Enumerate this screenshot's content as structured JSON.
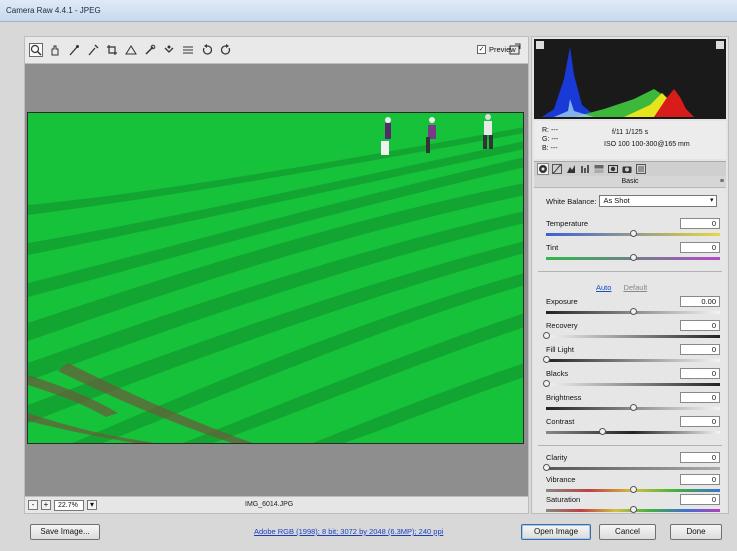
{
  "window": {
    "title": "Camera Raw 4.4.1  -  JPEG"
  },
  "toolbar": {
    "tools": [
      "zoom-icon",
      "hand-icon",
      "white-balance-icon",
      "color-sampler-icon",
      "crop-icon",
      "straighten-icon",
      "retouch-icon",
      "red-eye-icon",
      "preferences-icon",
      "rotate-ccw-icon",
      "rotate-cw-icon"
    ],
    "preview_label": "Preview",
    "preview_checked": "✓"
  },
  "status": {
    "zoom_minus": "-",
    "zoom_plus": "+",
    "zoom_value": "22.7%",
    "filename": "IMG_6014.JPG"
  },
  "readout": {
    "r": "R:   ---",
    "g": "G:   ---",
    "b": "B:   ---",
    "aperture_shutter": "f/11   1/125 s",
    "iso_lens": "ISO 100   100-300@165 mm"
  },
  "panel": {
    "section_title": "Basic",
    "white_balance_label": "White Balance:",
    "white_balance_value": "As Shot",
    "auto_label": "Auto",
    "default_label": "Default",
    "sliders": [
      {
        "label": "Temperature",
        "value": "0"
      },
      {
        "label": "Tint",
        "value": "0"
      },
      {
        "label": "Exposure",
        "value": "0.00"
      },
      {
        "label": "Recovery",
        "value": "0"
      },
      {
        "label": "Fill Light",
        "value": "0"
      },
      {
        "label": "Blacks",
        "value": "0"
      },
      {
        "label": "Brightness",
        "value": "0"
      },
      {
        "label": "Contrast",
        "value": "0"
      },
      {
        "label": "Clarity",
        "value": "0"
      },
      {
        "label": "Vibrance",
        "value": "0"
      },
      {
        "label": "Saturation",
        "value": "0"
      }
    ]
  },
  "buttons": {
    "save": "Save Image...",
    "workflow": "Adobe RGB (1998); 8 bit; 3072 by 2048 (6.3MP); 240 ppi",
    "open": "Open Image",
    "cancel": "Cancel",
    "done": "Done"
  },
  "colors": {
    "photo_green": "#18c83a",
    "link_blue": "#1a3ec0"
  }
}
